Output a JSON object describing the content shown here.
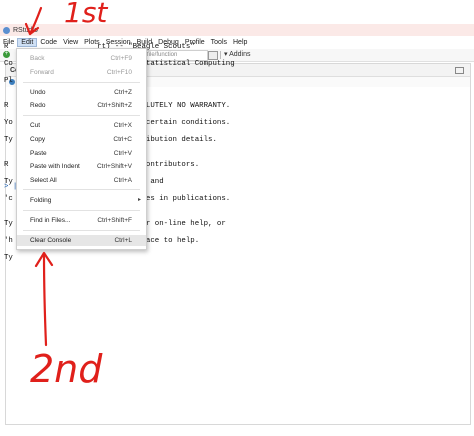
{
  "window": {
    "title": "RStudio"
  },
  "menubar": [
    "File",
    "Edit",
    "Code",
    "View",
    "Plots",
    "Session",
    "Build",
    "Debug",
    "Profile",
    "Tools",
    "Help"
  ],
  "toolbar": {
    "goto_placeholder": "file/function",
    "addins": "Addins"
  },
  "console": {
    "tab_label": "Co",
    "lines": [
      "R                    rt) -- \"Beagle Scouts\"",
      "Co                   ation for Statistical Computing",
      "Pl                   64 (64-bit)",
      "",
      "R                    e with ABSOLUTELY NO WARRANTY.",
      "Yo                   e it under certain conditions.",
      "Ty                   \" for distribution details.",
      "",
      "R                    with many contributors.",
      "Ty                   information and",
      "'c                   or R packages in publications.",
      "",
      "Ty                   'help()' for on-line help, or",
      "'h                   wser interface to help.",
      "Ty"
    ],
    "prompt": "> |"
  },
  "edit_menu": [
    {
      "label": "Back",
      "shortcut": "Ctrl+F9",
      "disabled": true
    },
    {
      "label": "Forward",
      "shortcut": "Ctrl+F10",
      "disabled": true
    },
    {
      "label": "Undo",
      "shortcut": "Ctrl+Z"
    },
    {
      "label": "Redo",
      "shortcut": "Ctrl+Shift+Z"
    },
    {
      "label": "Cut",
      "shortcut": "Ctrl+X"
    },
    {
      "label": "Copy",
      "shortcut": "Ctrl+C"
    },
    {
      "label": "Paste",
      "shortcut": "Ctrl+V"
    },
    {
      "label": "Paste with Indent",
      "shortcut": "Ctrl+Shift+V"
    },
    {
      "label": "Select All",
      "shortcut": "Ctrl+A"
    },
    {
      "label": "Folding",
      "shortcut": ""
    },
    {
      "label": "Find in Files...",
      "shortcut": "Ctrl+Shift+F"
    },
    {
      "label": "Clear Console",
      "shortcut": "Ctrl+L"
    }
  ],
  "annotations": {
    "first": "1st",
    "second": "2nd"
  },
  "colors": {
    "annotation": "#e0201b",
    "menu_highlight": "#cfe0f5"
  }
}
